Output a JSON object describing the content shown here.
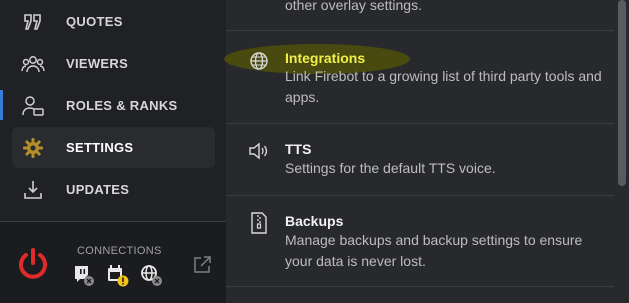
{
  "sidebar": {
    "items": [
      {
        "label": "QUOTES",
        "icon": "quote-icon"
      },
      {
        "label": "VIEWERS",
        "icon": "users-icon"
      },
      {
        "label": "ROLES & RANKS",
        "icon": "user-badge-icon"
      },
      {
        "label": "SETTINGS",
        "icon": "gear-icon",
        "active": true
      },
      {
        "label": "UPDATES",
        "icon": "download-icon"
      }
    ],
    "connections_label": "CONNECTIONS"
  },
  "settings": {
    "top_partial_desc": "other overlay settings.",
    "rows": [
      {
        "title": "Integrations",
        "desc": "Link Firebot to a growing list of third party tools and apps.",
        "icon": "globe-icon"
      },
      {
        "title": "TTS",
        "desc": "Settings for the default TTS voice.",
        "icon": "speaker-icon"
      },
      {
        "title": "Backups",
        "desc": "Manage backups and backup settings to ensure your data is never lost.",
        "icon": "file-zip-icon"
      }
    ]
  },
  "colors": {
    "accent_yellow": "#f2ef4a",
    "power_red": "#e02b2b",
    "gear_gold": "#b58e2c",
    "warning_yellow": "#f0c419"
  }
}
